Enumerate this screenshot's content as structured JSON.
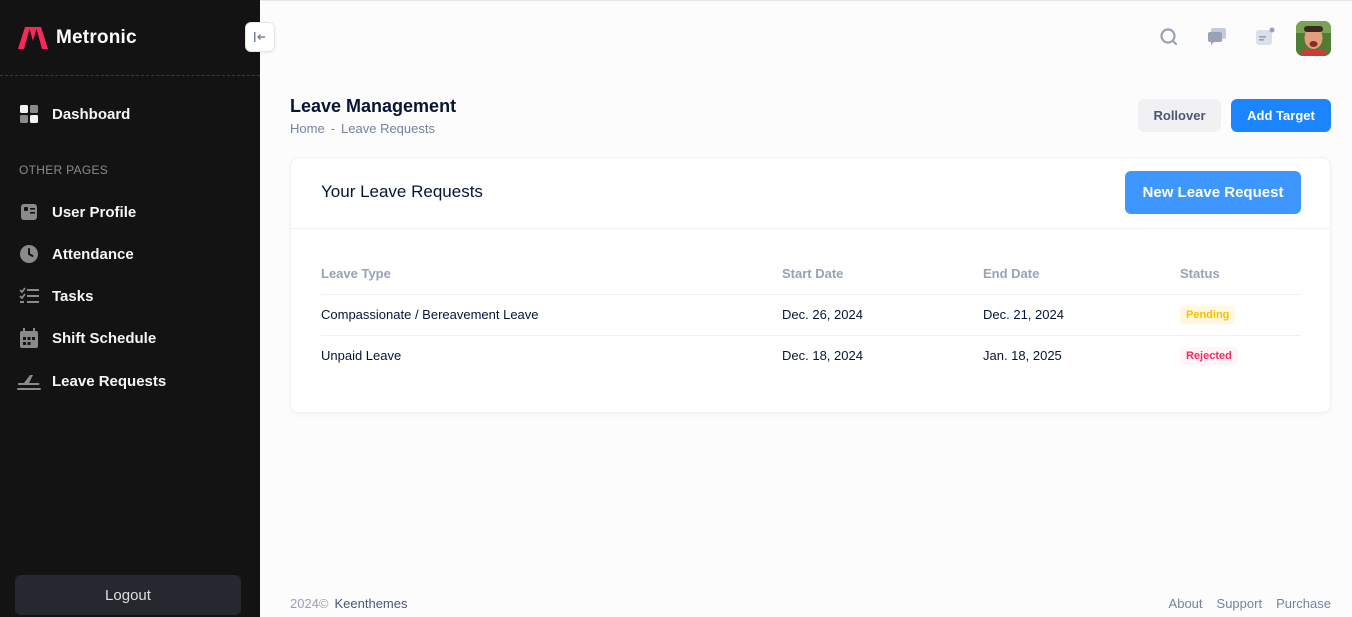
{
  "sidebar": {
    "brand": "Metronic",
    "items": [
      {
        "label": "Dashboard",
        "icon": "dashboard-icon"
      },
      {
        "label": "User Profile",
        "icon": "profile-icon"
      },
      {
        "label": "Attendance",
        "icon": "clock-icon"
      },
      {
        "label": "Tasks",
        "icon": "tasks-icon"
      },
      {
        "label": "Shift Schedule",
        "icon": "calendar-icon"
      },
      {
        "label": "Leave Requests",
        "icon": "airplane-icon"
      }
    ],
    "section_label": "OTHER PAGES",
    "logout_label": "Logout"
  },
  "topbar": {
    "icons": [
      "search-icon",
      "messages-icon",
      "notifications-icon"
    ]
  },
  "page": {
    "title": "Leave Management",
    "breadcrumb": [
      "Home",
      "-",
      "Leave Requests"
    ],
    "rollover_label": "Rollover",
    "add_target_label": "Add Target"
  },
  "card": {
    "title": "Your Leave Requests",
    "new_button_label": "New Leave Request",
    "columns": [
      "Leave Type",
      "Start Date",
      "End Date",
      "Status"
    ],
    "rows": [
      {
        "type": "Compassionate / Bereavement Leave",
        "start": "Dec. 26, 2024",
        "end": "Dec. 21, 2024",
        "status": "Pending"
      },
      {
        "type": "Unpaid Leave",
        "start": "Dec. 18, 2024",
        "end": "Jan. 18, 2025",
        "status": "Rejected"
      }
    ]
  },
  "footer": {
    "year": "2024©",
    "owner": "Keenthemes",
    "links": [
      "About",
      "Support",
      "Purchase"
    ]
  },
  "colors": {
    "sidebar_bg": "#131313",
    "primary": "#1b84ff",
    "pending": "#f6c000",
    "rejected": "#f8285a",
    "brand": "#f8285a"
  }
}
